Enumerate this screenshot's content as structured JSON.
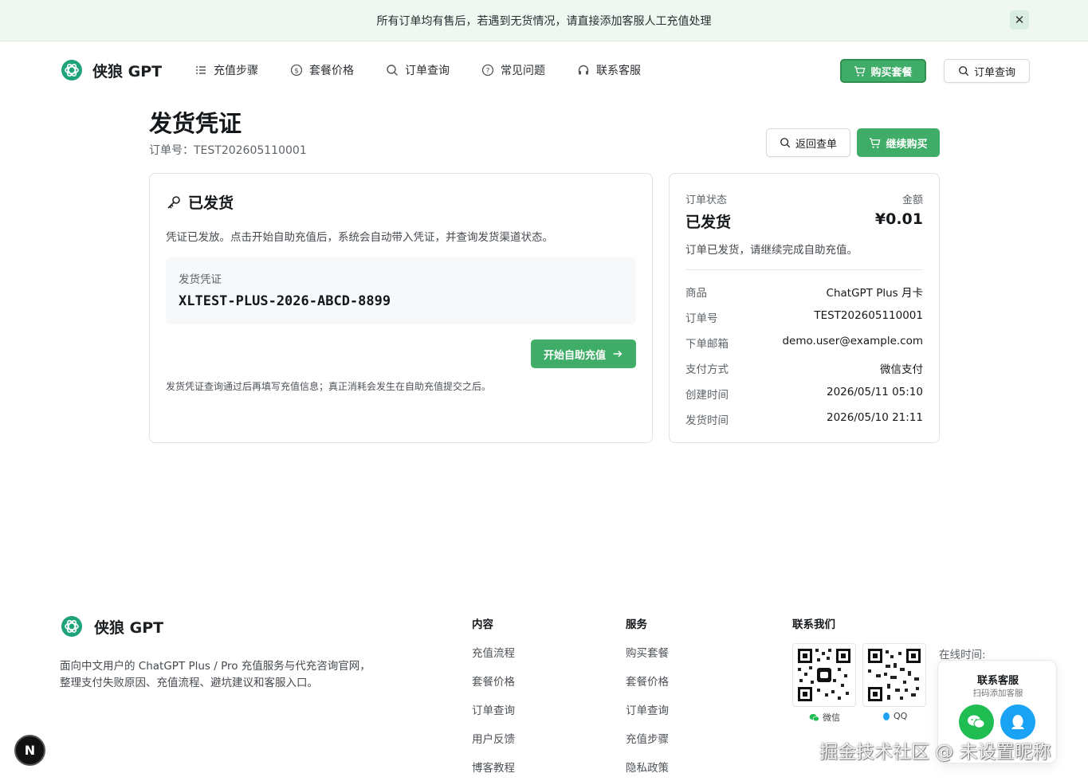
{
  "banner": {
    "text": "所有订单均有售后，若遇到无货情况，请直接添加客服人工充值处理",
    "close_icon": "✕"
  },
  "header": {
    "brand": "侠狼 GPT",
    "nav": [
      {
        "label": "充值步骤",
        "icon": "list-icon"
      },
      {
        "label": "套餐价格",
        "icon": "dollar-icon"
      },
      {
        "label": "订单查询",
        "icon": "search-icon"
      },
      {
        "label": "常见问题",
        "icon": "help-icon"
      },
      {
        "label": "联系客服",
        "icon": "headset-icon"
      }
    ],
    "buy_label": "购买套餐",
    "query_label": "订单查询"
  },
  "page": {
    "title": "发货凭证",
    "order_prefix": "订单号：",
    "order_no": "TEST202605110001",
    "back_label": "返回查单",
    "continue_label": "继续购买"
  },
  "delivery": {
    "heading": "已发货",
    "desc": "凭证已发放。点击开始自助充值后，系统会自动带入凭证，并查询发货渠道状态。",
    "voucher_label": "发货凭证",
    "voucher_code": "XLTEST-PLUS-2026-ABCD-8899",
    "start_label": "开始自助充值",
    "note": "发货凭证查询通过后再填写充值信息；真正消耗会发生在自助充值提交之后。"
  },
  "summary": {
    "status_label": "订单状态",
    "amount_label": "金额",
    "status_value": "已发货",
    "amount_value": "¥0.01",
    "note": "订单已发货，请继续完成自助充值。",
    "rows": [
      {
        "key": "商品",
        "value": "ChatGPT Plus 月卡"
      },
      {
        "key": "订单号",
        "value": "TEST202605110001"
      },
      {
        "key": "下单邮箱",
        "value": "demo.user@example.com"
      },
      {
        "key": "支付方式",
        "value": "微信支付"
      },
      {
        "key": "创建时间",
        "value": "2026/05/11 05:10"
      },
      {
        "key": "发货时间",
        "value": "2026/05/10 21:11"
      }
    ]
  },
  "footer": {
    "brand": "侠狼 GPT",
    "desc": "面向中文用户的 ChatGPT Plus / Pro 充值服务与代充咨询官网，整理支付失败原因、充值流程、避坑建议和客服入口。",
    "col1_title": "内容",
    "col1": [
      "充值流程",
      "套餐价格",
      "订单查询",
      "用户反馈",
      "博客教程"
    ],
    "col2_title": "服务",
    "col2": [
      "购买套餐",
      "套餐价格",
      "订单查询",
      "充值步骤",
      "隐私政策"
    ],
    "contact_title": "联系我们",
    "qr_wechat_caption": "微信",
    "qr_qq_caption": "QQ",
    "online_time_label": "在线时间:"
  },
  "float_card": {
    "title": "联系客服",
    "subtitle": "扫码添加客服"
  },
  "dev_badge": "N",
  "watermark": "掘金技术社区 @ 未设置昵称",
  "colors": {
    "accent": "#3fad67",
    "banner_bg": "#eef8f1",
    "wechat": "#1fbd52",
    "qq": "#1aa3f5"
  }
}
